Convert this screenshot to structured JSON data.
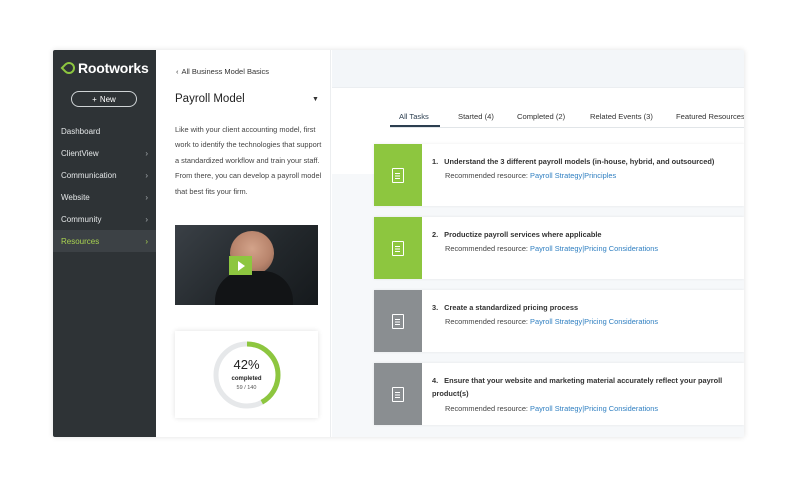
{
  "sidebar": {
    "brand": "Rootworks",
    "new_button": "New",
    "items": [
      {
        "label": "Dashboard",
        "chevron": false,
        "active": false
      },
      {
        "label": "ClientView",
        "chevron": true,
        "active": false
      },
      {
        "label": "Communication",
        "chevron": true,
        "active": false
      },
      {
        "label": "Website",
        "chevron": true,
        "active": false
      },
      {
        "label": "Community",
        "chevron": true,
        "active": false
      },
      {
        "label": "Resources",
        "chevron": true,
        "active": true
      }
    ]
  },
  "panel": {
    "back_link": "All Business Model Basics",
    "title": "Payroll Model",
    "description": "Like with your client accounting model, first work to identify the technologies that support a standardized workflow and train your staff. From there, you can develop a payroll model that best fits your firm.",
    "progress": {
      "percent_label": "42%",
      "percent_value": 42,
      "completed_label": "completed",
      "count": "59 / 140"
    }
  },
  "tabs": [
    {
      "label": "All Tasks",
      "active": true
    },
    {
      "label": "Started (4)",
      "active": false
    },
    {
      "label": "Completed (2)",
      "active": false
    },
    {
      "label": "Related Events (3)",
      "active": false
    },
    {
      "label": "Featured Resources",
      "active": false
    }
  ],
  "tasks": [
    {
      "number": "1.",
      "title": "Understand the 3 different payroll models (in-house, hybrid, and outsourced)",
      "resource_prefix": "Recommended resource:",
      "links": [
        "Payroll Strategy",
        "Principles"
      ],
      "status": "green"
    },
    {
      "number": "2.",
      "title": "Productize payroll services where applicable",
      "resource_prefix": "Recommended resource:",
      "links": [
        "Payroll Strategy",
        "Pricing Considerations"
      ],
      "status": "green"
    },
    {
      "number": "3.",
      "title": "Create a standardized pricing process",
      "resource_prefix": "Recommended resource:",
      "links": [
        "Payroll Strategy",
        "Pricing Considerations"
      ],
      "status": "gray"
    },
    {
      "number": "4.",
      "title": "Ensure that your website and marketing material accurately reflect your payroll product(s)",
      "resource_prefix": "Recommended resource:",
      "links": [
        "Payroll Strategy",
        "Pricing Considerations"
      ],
      "status": "gray"
    }
  ],
  "colors": {
    "sidebar_bg": "#2e3336",
    "accent_green": "#8dc63f",
    "task_gray": "#8a8e91",
    "link_blue": "#2f7fc1"
  },
  "icons": {
    "logo": "leaf-icon",
    "new": "plus-icon",
    "nav_chevron": "chevron-right-icon",
    "back": "chevron-left-icon",
    "panel_dropdown": "caret-down-icon",
    "task": "document-icon",
    "video": "play-icon"
  }
}
